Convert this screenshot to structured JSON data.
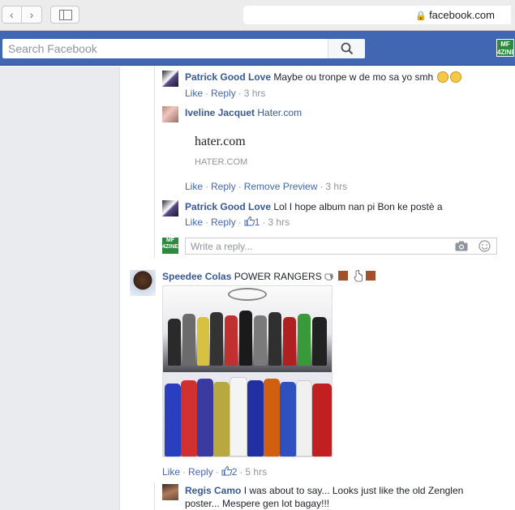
{
  "browser": {
    "url": "facebook.com"
  },
  "header": {
    "search_placeholder": "Search Facebook",
    "avatar_text": "MF 4ZINE"
  },
  "comments": [
    {
      "author": "Patrick Good Love",
      "text": "Maybe ou tronpe w de mo sa yo smh",
      "actions": {
        "like": "Like",
        "reply": "Reply",
        "time": "3 hrs"
      }
    },
    {
      "author": "Iveline Jacquet",
      "link": "Hater.com",
      "preview": {
        "title": "hater.com",
        "domain": "HATER.COM"
      },
      "actions": {
        "like": "Like",
        "reply": "Reply",
        "remove_preview": "Remove Preview",
        "time": "3 hrs"
      }
    },
    {
      "author": "Patrick Good Love",
      "text": "Lol I hope album nan pi Bon ke postè a",
      "actions": {
        "like": "Like",
        "reply": "Reply",
        "likes": "1",
        "time": "3 hrs"
      }
    }
  ],
  "reply_box": {
    "placeholder": "Write a reply..."
  },
  "post": {
    "author": "Speedee Colas",
    "text": "POWER RANGERS",
    "actions": {
      "like": "Like",
      "reply": "Reply",
      "likes": "2",
      "time": "5 hrs"
    }
  },
  "last_reply": {
    "author": "Regis Camo",
    "line1": "I was about to say... Looks just like the old Zenglen",
    "line2": "poster... Mespere gen lot bagay!!!"
  },
  "colors": {
    "fb_blue": "#4267b2",
    "link": "#385898",
    "meta": "#90949c"
  }
}
